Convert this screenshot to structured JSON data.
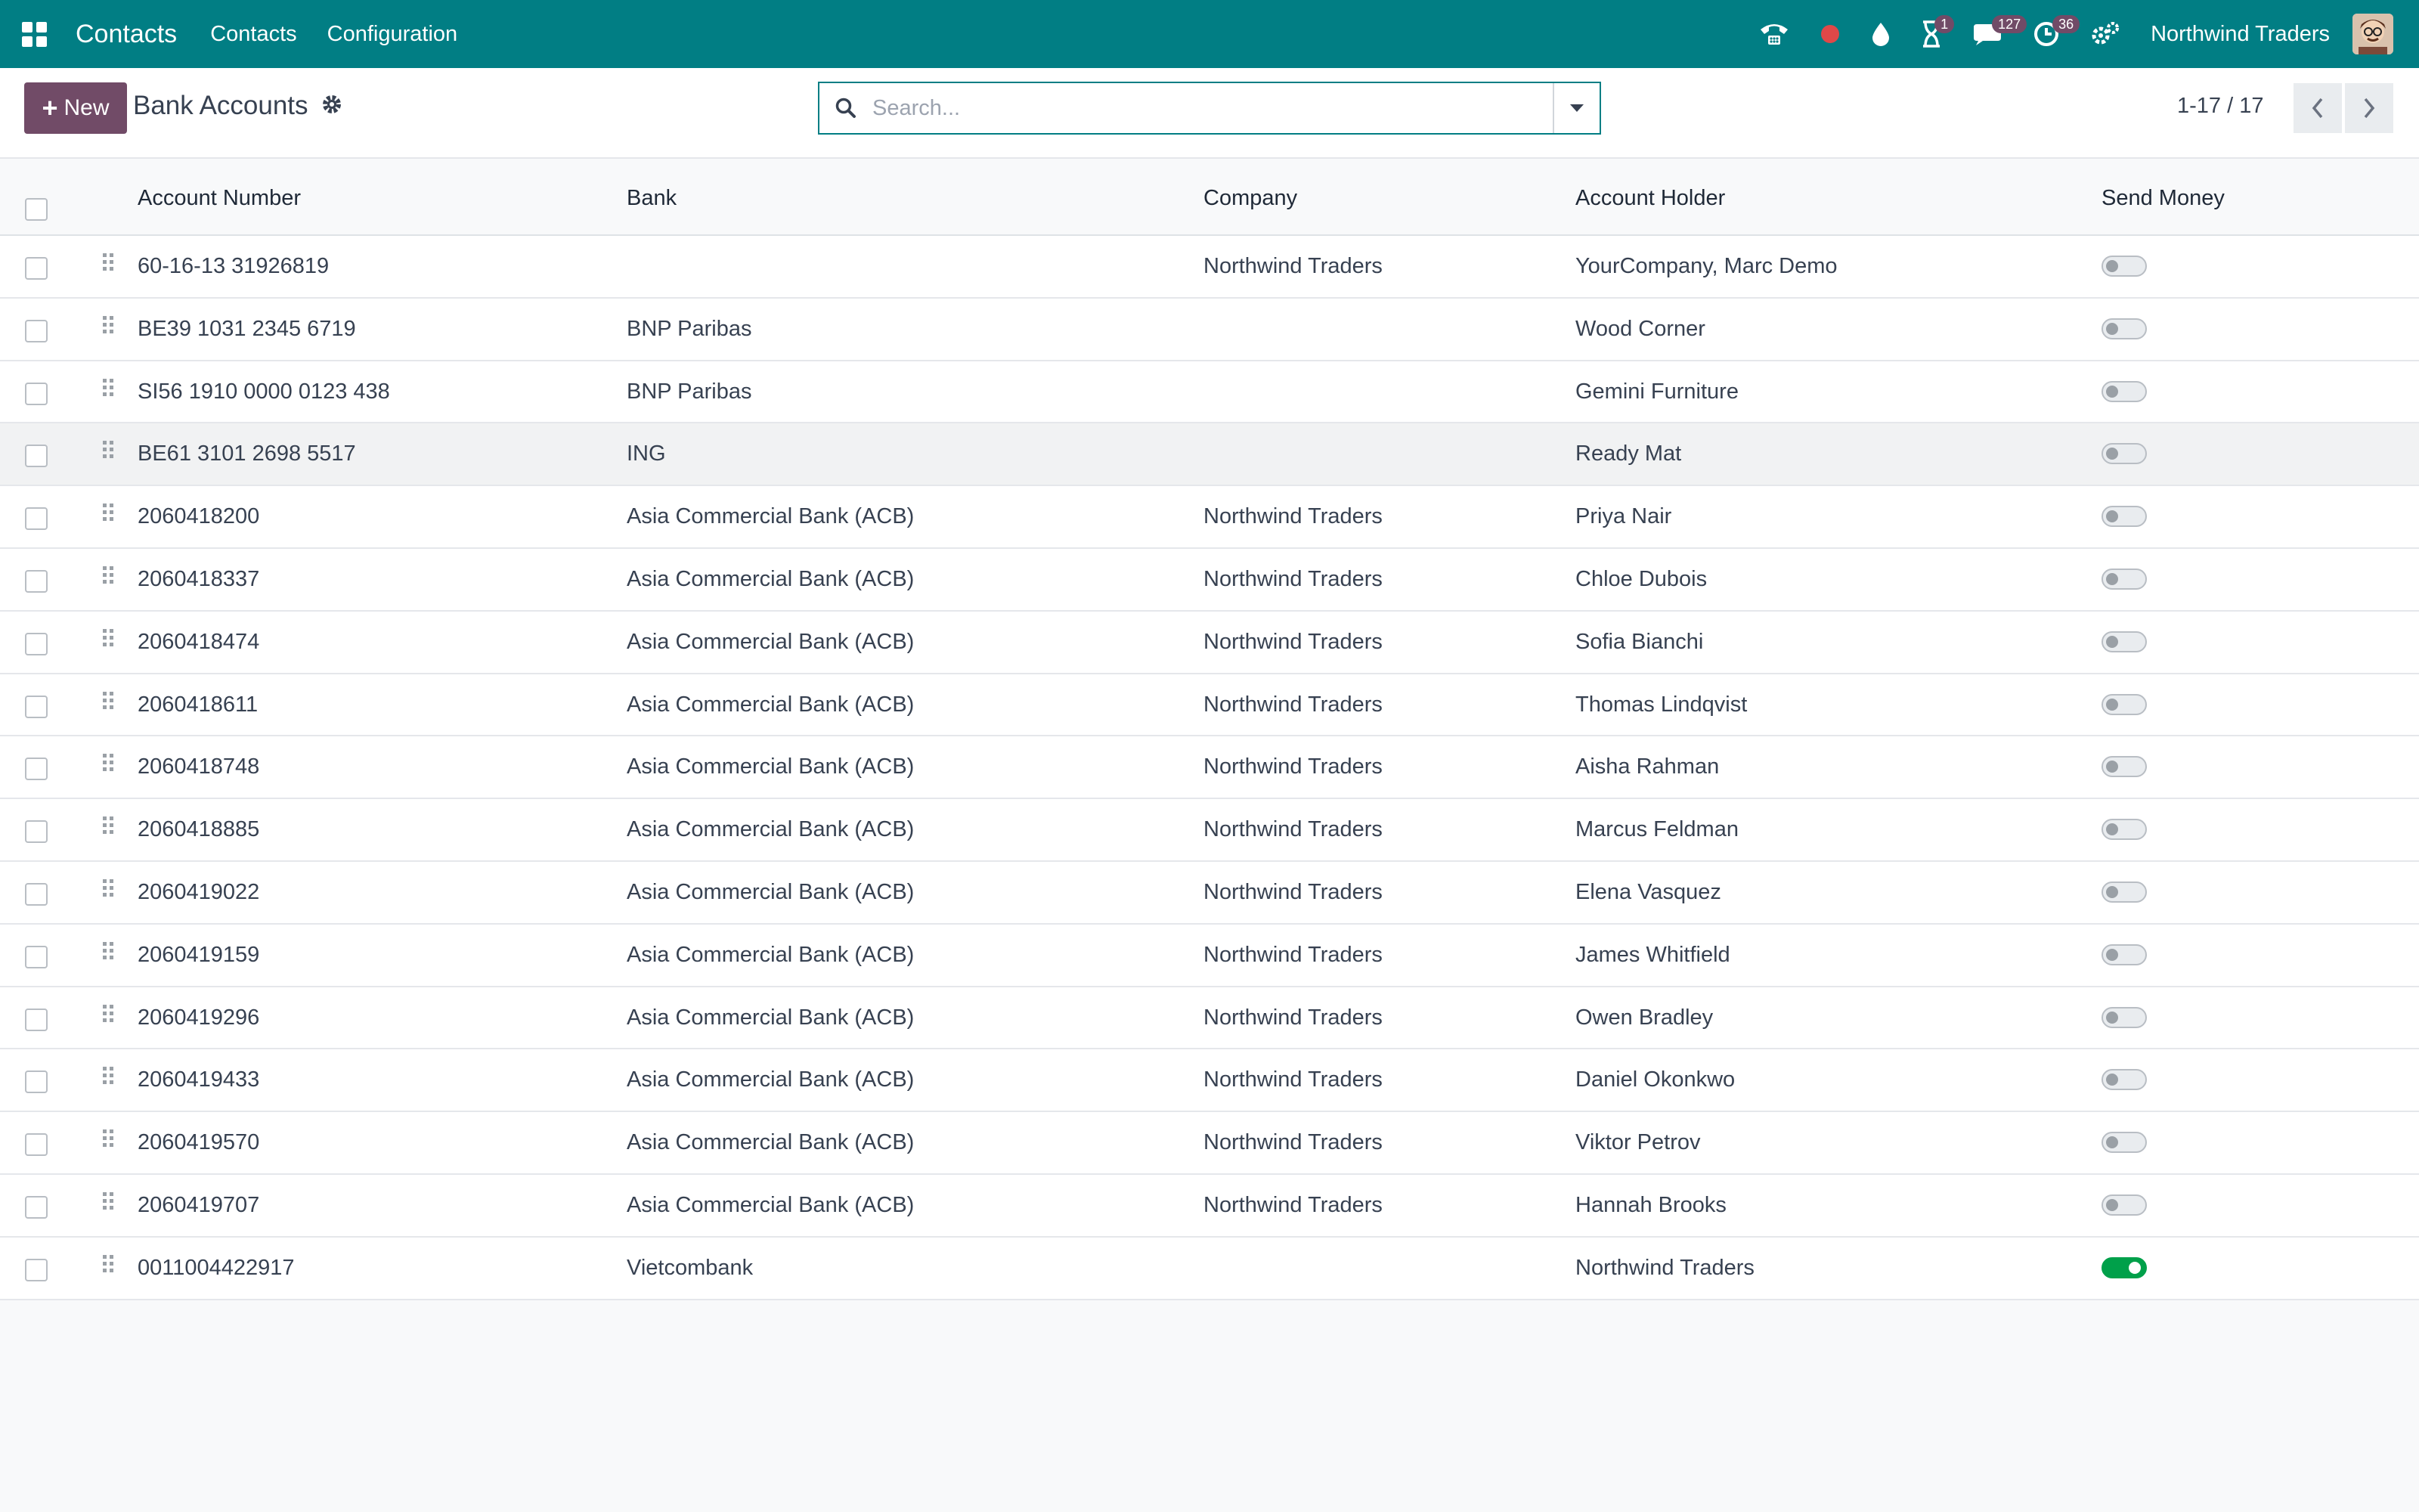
{
  "navbar": {
    "app_name": "Contacts",
    "menu": [
      "Contacts",
      "Configuration"
    ],
    "company": "Northwind Traders",
    "badges": {
      "activities": "1",
      "messages": "127",
      "clock": "36"
    },
    "colors": {
      "bar": "#017e84",
      "badge": "#714b67"
    }
  },
  "control": {
    "new_label": "New",
    "title": "Bank Accounts",
    "search_placeholder": "Search...",
    "pager": "1-17 / 17"
  },
  "table": {
    "columns": [
      "Account Number",
      "Bank",
      "Company",
      "Account Holder",
      "Send Money"
    ],
    "rows": [
      {
        "account": "60-16-13 31926819",
        "bank": "",
        "company": "Northwind Traders",
        "holder": "YourCompany, Marc Demo",
        "send_money": false
      },
      {
        "account": "BE39 1031 2345 6719",
        "bank": "BNP Paribas",
        "company": "",
        "holder": "Wood Corner",
        "send_money": false
      },
      {
        "account": "SI56 1910 0000 0123 438",
        "bank": "BNP Paribas",
        "company": "",
        "holder": "Gemini Furniture",
        "send_money": false
      },
      {
        "account": "BE61 3101 2698 5517",
        "bank": "ING",
        "company": "",
        "holder": "Ready Mat",
        "send_money": false
      },
      {
        "account": "2060418200",
        "bank": "Asia Commercial Bank (ACB)",
        "company": "Northwind Traders",
        "holder": "Priya Nair",
        "send_money": false
      },
      {
        "account": "2060418337",
        "bank": "Asia Commercial Bank (ACB)",
        "company": "Northwind Traders",
        "holder": "Chloe Dubois",
        "send_money": false
      },
      {
        "account": "2060418474",
        "bank": "Asia Commercial Bank (ACB)",
        "company": "Northwind Traders",
        "holder": "Sofia Bianchi",
        "send_money": false
      },
      {
        "account": "2060418611",
        "bank": "Asia Commercial Bank (ACB)",
        "company": "Northwind Traders",
        "holder": "Thomas Lindqvist",
        "send_money": false
      },
      {
        "account": "2060418748",
        "bank": "Asia Commercial Bank (ACB)",
        "company": "Northwind Traders",
        "holder": "Aisha Rahman",
        "send_money": false
      },
      {
        "account": "2060418885",
        "bank": "Asia Commercial Bank (ACB)",
        "company": "Northwind Traders",
        "holder": "Marcus Feldman",
        "send_money": false
      },
      {
        "account": "2060419022",
        "bank": "Asia Commercial Bank (ACB)",
        "company": "Northwind Traders",
        "holder": "Elena Vasquez",
        "send_money": false
      },
      {
        "account": "2060419159",
        "bank": "Asia Commercial Bank (ACB)",
        "company": "Northwind Traders",
        "holder": "James Whitfield",
        "send_money": false
      },
      {
        "account": "2060419296",
        "bank": "Asia Commercial Bank (ACB)",
        "company": "Northwind Traders",
        "holder": "Owen Bradley",
        "send_money": false
      },
      {
        "account": "2060419433",
        "bank": "Asia Commercial Bank (ACB)",
        "company": "Northwind Traders",
        "holder": "Daniel Okonkwo",
        "send_money": false
      },
      {
        "account": "2060419570",
        "bank": "Asia Commercial Bank (ACB)",
        "company": "Northwind Traders",
        "holder": "Viktor Petrov",
        "send_money": false
      },
      {
        "account": "2060419707",
        "bank": "Asia Commercial Bank (ACB)",
        "company": "Northwind Traders",
        "holder": "Hannah Brooks",
        "send_money": false
      },
      {
        "account": "0011004422917",
        "bank": "Vietcombank",
        "company": "",
        "holder": "Northwind Traders",
        "send_money": true
      }
    ]
  }
}
